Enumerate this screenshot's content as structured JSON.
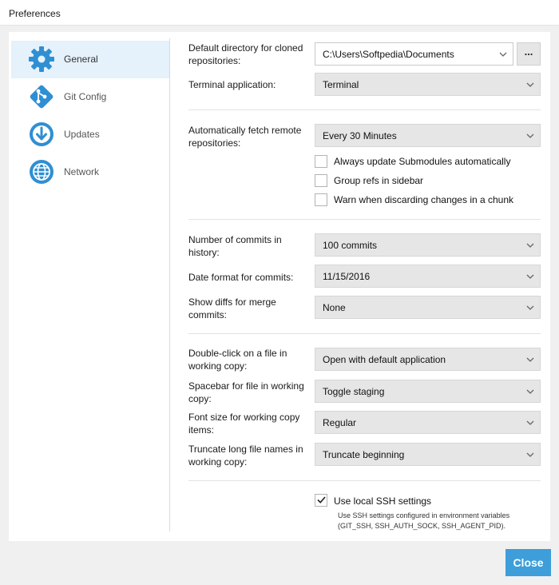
{
  "window": {
    "title": "Preferences"
  },
  "sidebar": {
    "items": [
      {
        "label": "General",
        "icon": "gear-icon",
        "active": true
      },
      {
        "label": "Git Config",
        "icon": "git-icon",
        "active": false
      },
      {
        "label": "Updates",
        "icon": "download-icon",
        "active": false
      },
      {
        "label": "Network",
        "icon": "globe-icon",
        "active": false
      }
    ]
  },
  "general": {
    "default_directory": {
      "label": "Default directory for cloned repositories:",
      "value": "C:\\Users\\Softpedia\\Documents",
      "browse_label": "..."
    },
    "terminal": {
      "label": "Terminal application:",
      "value": "Terminal"
    },
    "auto_fetch": {
      "label": "Automatically fetch remote repositories:",
      "value": "Every 30 Minutes"
    },
    "checkboxes": [
      {
        "label": "Always update Submodules automatically",
        "checked": false
      },
      {
        "label": "Group refs in sidebar",
        "checked": false
      },
      {
        "label": "Warn when discarding changes in a chunk",
        "checked": false
      }
    ],
    "commits_in_history": {
      "label": "Number of commits in history:",
      "value": "100 commits"
    },
    "date_format": {
      "label": "Date format for commits:",
      "value": "11/15/2016"
    },
    "merge_diffs": {
      "label": "Show diffs for merge commits:",
      "value": "None"
    },
    "double_click": {
      "label": "Double-click on a file in working copy:",
      "value": "Open with default application"
    },
    "spacebar": {
      "label": "Spacebar for file in working copy:",
      "value": "Toggle staging"
    },
    "font_size": {
      "label": "Font size for working copy items:",
      "value": "Regular"
    },
    "truncate": {
      "label": "Truncate long file names in working copy:",
      "value": "Truncate beginning"
    },
    "ssh": {
      "label": "Use local SSH settings",
      "checked": true,
      "description": "Use SSH settings configured in environment variables (GIT_SSH, SSH_AUTH_SOCK, SSH_AGENT_PID)."
    }
  },
  "footer": {
    "close_label": "Close"
  },
  "colors": {
    "accent": "#3d9ed9",
    "active_bg": "#e5f1fb"
  }
}
